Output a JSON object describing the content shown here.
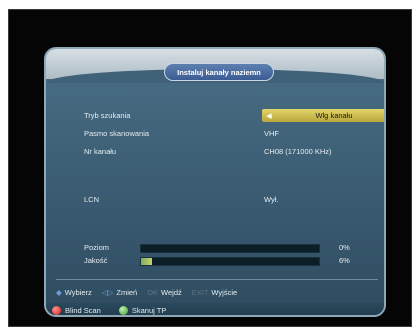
{
  "title": "Instaluj kanały naziemn",
  "settings": [
    {
      "label": "Tryb szukania",
      "value": "Wlg kanału",
      "selected": true
    },
    {
      "label": "Pasmo skanowania",
      "value": "VHF"
    },
    {
      "label": "Nr kanału",
      "value": "CH08 (171000 KHz)"
    },
    {
      "label": "",
      "value": ""
    },
    {
      "label": "LCN",
      "value": "Wył."
    }
  ],
  "meters": [
    {
      "label": "Poziom",
      "percent_text": "0%",
      "level": 0
    },
    {
      "label": "Jakość",
      "percent_text": "6%",
      "level": 6
    }
  ],
  "help": [
    {
      "key": "◆",
      "label": "Wybierz"
    },
    {
      "key": "◁▷",
      "label": "Zmień"
    },
    {
      "key": "OK",
      "label": "Wejdź"
    },
    {
      "key": "EXIT",
      "label": "Wyjście"
    }
  ],
  "color_keys": [
    {
      "color": "#d8261f",
      "label": "Blind Scan"
    },
    {
      "color": "#3f9c2f",
      "label": "Skanuj TP"
    }
  ]
}
